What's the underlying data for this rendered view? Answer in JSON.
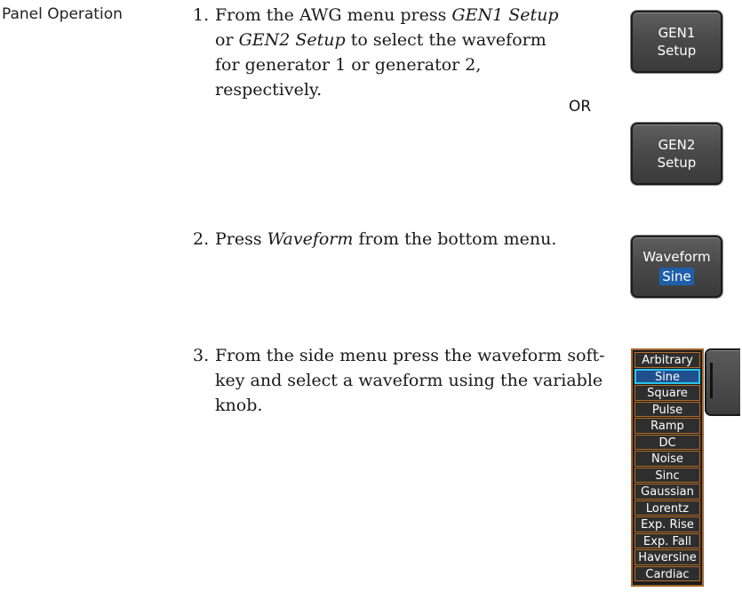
{
  "section_label": "Panel Operation",
  "steps": [
    {
      "number": "1.",
      "parts": [
        "From the AWG menu press ",
        "GEN1 Setup",
        " or ",
        "GEN2 Setup",
        " to select the waveform for generator 1 or generator 2, respectively."
      ]
    },
    {
      "number": "2.",
      "parts": [
        "Press ",
        "Waveform",
        " from the bottom menu."
      ]
    },
    {
      "number": "3.",
      "parts": [
        "From the side menu press the waveform soft-key and select a waveform using the variable knob."
      ]
    }
  ],
  "or_label": "OR",
  "softkeys": {
    "gen1": {
      "line1": "GEN1",
      "line2": "Setup"
    },
    "gen2": {
      "line1": "GEN2",
      "line2": "Setup"
    },
    "waveform": {
      "line1": "Waveform",
      "value": "Sine"
    }
  },
  "waveform_list": {
    "selected": "Sine",
    "items": [
      "Arbitrary",
      "Sine",
      "Square",
      "Pulse",
      "Ramp",
      "DC",
      "Noise",
      "Sinc",
      "Gaussian",
      "Lorentz",
      "Exp. Rise",
      "Exp. Fall",
      "Haversine",
      "Cardiac"
    ]
  },
  "colors": {
    "softkey_highlight": "#1f5fa8",
    "list_border": "#b06f2c",
    "list_selected_border": "#29c6ee"
  }
}
